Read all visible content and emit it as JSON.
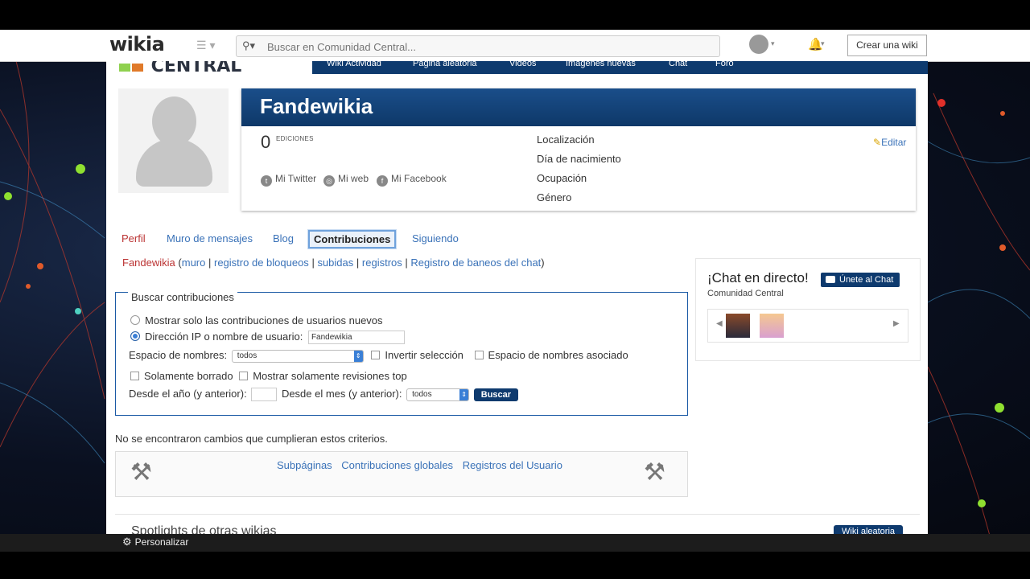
{
  "topbar": {
    "logo": "wikia",
    "search_placeholder": "Buscar en Comunidad Central...",
    "create_wiki": "Crear una wiki"
  },
  "wiki": {
    "logo_text": "CENTRAL",
    "nav": [
      "Wiki Actividad",
      "Página aleatoria",
      "Videos",
      "Imágenes nuevas",
      "Chat",
      "Foro"
    ]
  },
  "profile": {
    "username": "Fandewikia",
    "edits_count": "0",
    "edits_label": "EDICIONES",
    "social": [
      "Mi Twitter",
      "Mi web",
      "Mi Facebook"
    ],
    "info": [
      "Localización",
      "Día de nacimiento",
      "Ocupación",
      "Género"
    ],
    "edit_label": "Editar"
  },
  "tabs": [
    "Perfil",
    "Muro de mensajes",
    "Blog",
    "Contribuciones",
    "Siguiendo"
  ],
  "links_line": {
    "user": "Fandewikia",
    "open_paren": "(",
    "links": [
      "muro",
      "registro de bloqueos",
      "subidas",
      "registros",
      "Registro de baneos del chat"
    ],
    "sep": "|",
    "close_paren": ")"
  },
  "search_box": {
    "legend": "Buscar contribuciones",
    "radio_new_users": "Mostrar solo las contribuciones de usuarios nuevos",
    "radio_ip_user": "Dirección IP o nombre de usuario:",
    "user_value": "Fandewikia",
    "namespace_label": "Espacio de nombres:",
    "namespace_value": "todos",
    "invert_label": "Invertir selección",
    "associated_label": "Espacio de nombres asociado",
    "deleted_only": "Solamente borrado",
    "top_only": "Mostrar solamente revisiones top",
    "year_label": "Desde el año (y anterior):",
    "month_label": "Desde el mes (y anterior):",
    "month_value": "todos",
    "search_button": "Buscar"
  },
  "no_results": "No se encontraron cambios que cumplieran estos criterios.",
  "footer_links": [
    "Subpáginas",
    "Contribuciones globales",
    "Registros del Usuario"
  ],
  "spotlights": {
    "title": "Spotlights de otras wikias",
    "button": "Wiki aleatoria"
  },
  "chat": {
    "title": "¡Chat en directo!",
    "join": "Únete al Chat",
    "subtitle": "Comunidad Central"
  },
  "bottombar": {
    "customize": "Personalizar"
  },
  "colors": {
    "brand_blue": "#0e3a6e",
    "link": "#3a72b8",
    "user_red": "#b33333"
  }
}
